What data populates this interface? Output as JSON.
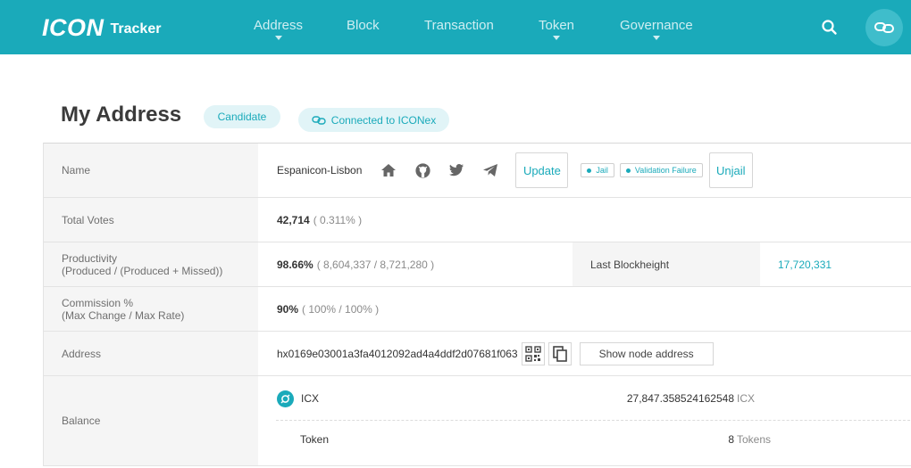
{
  "header": {
    "logo_main": "ICON",
    "logo_sub": "Tracker",
    "nav": [
      "Address",
      "Block",
      "Transaction",
      "Token",
      "Governance"
    ],
    "colors": {
      "brand": "#1aaaba",
      "nav_text": "#cfeef2"
    }
  },
  "page": {
    "title": "My Address",
    "candidate_badge": "Candidate",
    "connected_label": "Connected to ICONex"
  },
  "rows": {
    "name": {
      "label": "Name",
      "value": "Espanicon-Lisbon",
      "icons": [
        "home-icon",
        "github-icon",
        "twitter-icon",
        "telegram-icon"
      ],
      "update_label": "Update",
      "tags": [
        "Jail",
        "Validation Failure"
      ],
      "unjail_label": "Unjail"
    },
    "total_votes": {
      "label": "Total Votes",
      "value": "42,714",
      "percent": "( 0.311% )"
    },
    "productivity": {
      "label_line1": "Productivity",
      "label_line2": "(Produced / (Produced + Missed))",
      "value": "98.66%",
      "detail": "( 8,604,337 / 8,721,280 )",
      "last_block_label": "Last Blockheight",
      "last_block_value": "17,720,331"
    },
    "commission": {
      "label_line1": "Commission %",
      "label_line2": "(Max Change / Max Rate)",
      "value": "90%",
      "detail": "( 100% / 100% )"
    },
    "address": {
      "label": "Address",
      "value": "hx0169e03001a3fa4012092ad4a4ddf2d07681f063",
      "show_node_label": "Show node address"
    },
    "balance": {
      "label": "Balance",
      "icx_label": "ICX",
      "icx_value": "27,847.358524162548",
      "icx_unit": "ICX",
      "token_label": "Token",
      "token_value": "8",
      "token_unit": "Tokens"
    }
  }
}
